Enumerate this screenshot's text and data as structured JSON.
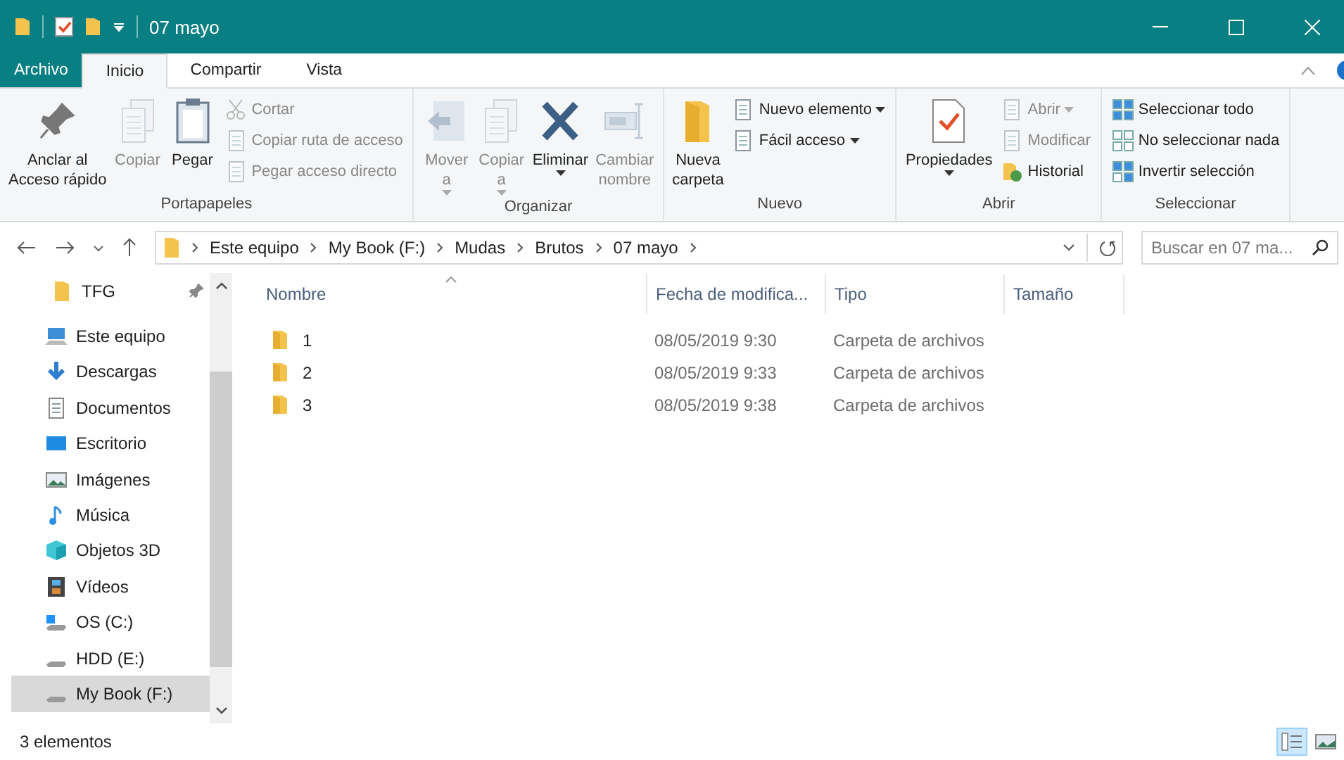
{
  "window": {
    "title": "07 mayo"
  },
  "ribbon_tabs": [
    {
      "label": "Archivo",
      "kind": "file",
      "selected": false
    },
    {
      "label": "Inicio",
      "kind": "tab",
      "selected": true
    },
    {
      "label": "Compartir",
      "kind": "tab",
      "selected": false
    },
    {
      "label": "Vista",
      "kind": "tab",
      "selected": false
    }
  ],
  "ribbon_groups": [
    {
      "label": "Portapapeles",
      "cells": [
        {
          "kind": "large",
          "label": "Anclar al\nAcceso rápido",
          "disabled": false,
          "dropdown": false
        },
        {
          "kind": "large",
          "label": "Copiar",
          "disabled": true,
          "dropdown": false
        },
        {
          "kind": "large",
          "label": "Pegar",
          "disabled": false,
          "dropdown": false
        },
        {
          "kind": "stack",
          "items": [
            {
              "label": "Cortar",
              "disabled": true,
              "dropdown": false
            },
            {
              "label": "Copiar ruta de acceso",
              "disabled": true,
              "dropdown": false
            },
            {
              "label": "Pegar acceso directo",
              "disabled": true,
              "dropdown": false
            }
          ]
        }
      ]
    },
    {
      "label": "Organizar",
      "cells": [
        {
          "kind": "large",
          "label": "Mover\na",
          "disabled": true,
          "dropdown": true
        },
        {
          "kind": "large",
          "label": "Copiar\na",
          "disabled": true,
          "dropdown": true
        },
        {
          "kind": "large",
          "label": "Eliminar",
          "disabled": false,
          "dropdown": true
        },
        {
          "kind": "large",
          "label": "Cambiar\nnombre",
          "disabled": true,
          "dropdown": false
        }
      ]
    },
    {
      "label": "Nuevo",
      "cells": [
        {
          "kind": "large",
          "label": "Nueva\ncarpeta",
          "disabled": false,
          "dropdown": false
        },
        {
          "kind": "stack",
          "items": [
            {
              "label": "Nuevo elemento",
              "disabled": false,
              "dropdown": true
            },
            {
              "label": "Fácil acceso",
              "disabled": false,
              "dropdown": true
            }
          ]
        }
      ]
    },
    {
      "label": "Abrir",
      "cells": [
        {
          "kind": "large",
          "label": "Propiedades",
          "disabled": false,
          "dropdown": true
        },
        {
          "kind": "stack",
          "items": [
            {
              "label": "Abrir",
              "disabled": true,
              "dropdown": true
            },
            {
              "label": "Modificar",
              "disabled": true,
              "dropdown": false
            },
            {
              "label": "Historial",
              "disabled": false,
              "dropdown": false
            }
          ]
        }
      ]
    },
    {
      "label": "Seleccionar",
      "cells": [
        {
          "kind": "stack",
          "items": [
            {
              "label": "Seleccionar todo",
              "disabled": false,
              "dropdown": false
            },
            {
              "label": "No seleccionar nada",
              "disabled": false,
              "dropdown": false
            },
            {
              "label": "Invertir selección",
              "disabled": false,
              "dropdown": false
            }
          ]
        }
      ]
    }
  ],
  "address": {
    "segments": [
      "Este equipo",
      "My Book (F:)",
      "Mudas",
      "Brutos",
      "07 mayo"
    ]
  },
  "search": {
    "placeholder": "Buscar en 07 ma..."
  },
  "sidebar": {
    "items": [
      {
        "label": "TFG",
        "pinned": true,
        "selected": false
      },
      {
        "label": "Este equipo",
        "pinned": false,
        "selected": false
      },
      {
        "label": "Descargas",
        "pinned": false,
        "selected": false
      },
      {
        "label": "Documentos",
        "pinned": false,
        "selected": false
      },
      {
        "label": "Escritorio",
        "pinned": false,
        "selected": false
      },
      {
        "label": "Imágenes",
        "pinned": false,
        "selected": false
      },
      {
        "label": "Música",
        "pinned": false,
        "selected": false
      },
      {
        "label": "Objetos 3D",
        "pinned": false,
        "selected": false
      },
      {
        "label": "Vídeos",
        "pinned": false,
        "selected": false
      },
      {
        "label": "OS (C:)",
        "pinned": false,
        "selected": false
      },
      {
        "label": "HDD (E:)",
        "pinned": false,
        "selected": false
      },
      {
        "label": "My Book (F:)",
        "pinned": false,
        "selected": true
      }
    ]
  },
  "table": {
    "columns": [
      "Nombre",
      "Fecha de modifica...",
      "Tipo",
      "Tamaño"
    ],
    "rows": [
      {
        "name": "1",
        "modified": "08/05/2019 9:30",
        "type": "Carpeta de archivos"
      },
      {
        "name": "2",
        "modified": "08/05/2019 9:33",
        "type": "Carpeta de archivos"
      },
      {
        "name": "3",
        "modified": "08/05/2019 9:38",
        "type": "Carpeta de archivos"
      }
    ]
  },
  "status_bar": {
    "text": "3 elementos",
    "views": [
      {
        "kind": "details",
        "selected": true
      },
      {
        "kind": "large_icons",
        "selected": false
      }
    ]
  }
}
